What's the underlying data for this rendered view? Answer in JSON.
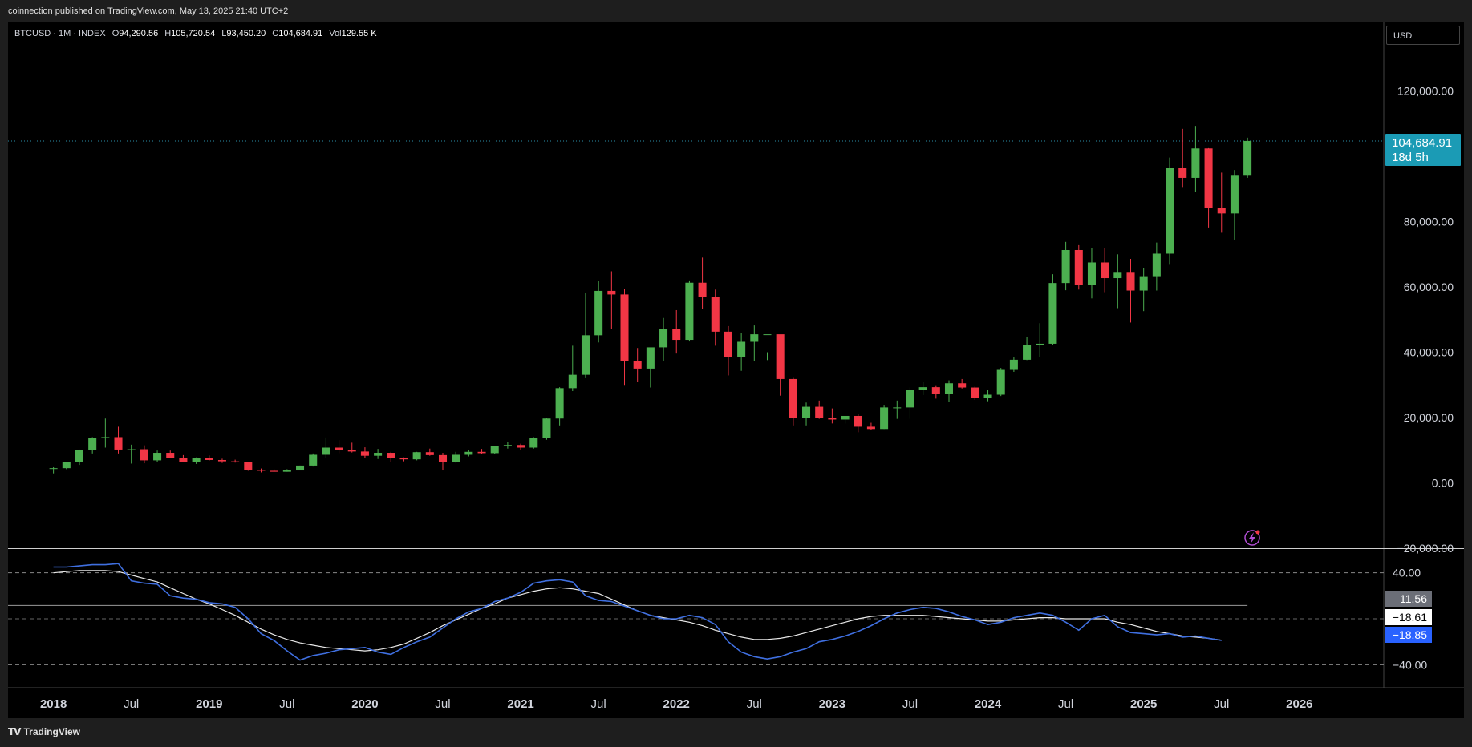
{
  "header": {
    "publisher_text": "coinnection published on TradingView.com, May 13, 2025 21:40 UTC+2"
  },
  "legend": {
    "symbol": "BTCUSD · 1M · INDEX",
    "o_label": "O",
    "o": "94,290.56",
    "h_label": "H",
    "h": "105,720.54",
    "l_label": "L",
    "l": "93,450.20",
    "c_label": "C",
    "c": "104,684.91",
    "vol_label": "Vol",
    "vol": "129.55 K"
  },
  "currency": "USD",
  "price_badge": {
    "price": "104,684.91",
    "countdown": "18d 5h",
    "color": "#1b9bb5"
  },
  "rsi_badges": [
    {
      "value": "11.56",
      "bg": "#6b6e77",
      "fg": "#ffffff"
    },
    {
      "value": "−18.61",
      "bg": "#ffffff",
      "fg": "#000000"
    },
    {
      "value": "−18.85",
      "bg": "#2962ff",
      "fg": "#ffffff"
    }
  ],
  "footer": {
    "brand": "TradingView",
    "logo_mark": "TV"
  },
  "colors": {
    "up": "#4caf50",
    "down": "#f23645",
    "rsi": "#3f6fe0",
    "signal": "#e8e8e8",
    "background": "#000000"
  },
  "chart_data": [
    {
      "type": "candlestick",
      "x_axis": {
        "tick_labels": [
          "2018",
          "Jul",
          "2019",
          "Jul",
          "2020",
          "Jul",
          "2021",
          "Jul",
          "2022",
          "Jul",
          "2023",
          "Jul",
          "2024",
          "Jul",
          "2025",
          "Jul",
          "2026"
        ],
        "tick_months": [
          0,
          6,
          12,
          18,
          24,
          30,
          36,
          42,
          48,
          54,
          60,
          66,
          72,
          78,
          84,
          90,
          96
        ],
        "range_months": [
          -3.5,
          102.5
        ]
      },
      "y_axis": {
        "ylim": [
          -20000,
          141000
        ],
        "tick_values": [
          -20000,
          0,
          20000,
          40000,
          60000,
          80000,
          120000
        ],
        "tick_labels": [
          "−20,000.00",
          "0.00",
          "20,000.00",
          "40,000.00",
          "60,000.00",
          "80,000.00",
          "120,000.00"
        ]
      },
      "last_price": 104684.91,
      "candles": [
        [
          4300,
          4800,
          2900,
          4500
        ],
        [
          4500,
          6500,
          4200,
          6300
        ],
        [
          6300,
          10200,
          5500,
          10000
        ],
        [
          10000,
          14000,
          9000,
          13800
        ],
        [
          13800,
          19700,
          10800,
          14000
        ],
        [
          14000,
          17200,
          9000,
          10200
        ],
        [
          10200,
          11700,
          5900,
          10300
        ],
        [
          10300,
          11500,
          6000,
          6900
        ],
        [
          6900,
          9900,
          6500,
          9200
        ],
        [
          9200,
          9900,
          8700,
          7500
        ],
        [
          7500,
          8500,
          7100,
          6400
        ],
        [
          6400,
          7800,
          5800,
          7700
        ],
        [
          7700,
          8400,
          6800,
          7000
        ],
        [
          7000,
          7400,
          6100,
          6600
        ],
        [
          6600,
          7100,
          6200,
          6300
        ],
        [
          6300,
          6500,
          3700,
          4000
        ],
        [
          4000,
          4400,
          3200,
          3700
        ],
        [
          3700,
          4100,
          3400,
          3400
        ],
        [
          3400,
          4200,
          3400,
          3800
        ],
        [
          3800,
          5300,
          3900,
          5300
        ],
        [
          5300,
          9000,
          5000,
          8600
        ],
        [
          8600,
          13900,
          7600,
          10800
        ],
        [
          10800,
          13100,
          9100,
          10100
        ],
        [
          10100,
          12300,
          9300,
          9600
        ],
        [
          9600,
          10900,
          7700,
          8300
        ],
        [
          8300,
          10400,
          7300,
          9200
        ],
        [
          9200,
          9500,
          6500,
          7600
        ],
        [
          7600,
          7800,
          6600,
          7200
        ],
        [
          7200,
          9500,
          6900,
          9400
        ],
        [
          9400,
          10500,
          8300,
          8500
        ],
        [
          8500,
          9200,
          3800,
          6400
        ],
        [
          6400,
          9500,
          6200,
          8600
        ],
        [
          8600,
          10000,
          8100,
          9500
        ],
        [
          9500,
          10400,
          8900,
          9100
        ],
        [
          9100,
          9800,
          8900,
          11300
        ],
        [
          11300,
          12500,
          10500,
          11600
        ],
        [
          11600,
          12000,
          10000,
          10800
        ],
        [
          10800,
          14000,
          10500,
          13800
        ],
        [
          13800,
          19800,
          13200,
          19700
        ],
        [
          19700,
          29300,
          17600,
          29000
        ],
        [
          29000,
          42000,
          28100,
          33100
        ],
        [
          33100,
          58300,
          32300,
          45200
        ],
        [
          45200,
          61800,
          43000,
          58800
        ],
        [
          58800,
          64800,
          47000,
          57700
        ],
        [
          57700,
          59500,
          30000,
          37300
        ],
        [
          37300,
          41300,
          31000,
          35000
        ],
        [
          35000,
          36600,
          29200,
          41500
        ],
        [
          41500,
          50500,
          37300,
          47100
        ],
        [
          47100,
          52900,
          39600,
          43800
        ],
        [
          43800,
          62000,
          43300,
          61300
        ],
        [
          61300,
          69000,
          53300,
          57000
        ],
        [
          57000,
          59200,
          42000,
          46300
        ],
        [
          46300,
          48000,
          32900,
          38500
        ],
        [
          38500,
          45800,
          34300,
          43200
        ],
        [
          43200,
          48200,
          37300,
          45500
        ],
        [
          45500,
          40000,
          37600,
          45500
        ],
        [
          45500,
          40000,
          26700,
          31800
        ],
        [
          31800,
          32400,
          17600,
          19800
        ],
        [
          19800,
          24600,
          17600,
          23300
        ],
        [
          23300,
          25200,
          19600,
          20000
        ],
        [
          20000,
          22800,
          18200,
          19400
        ],
        [
          19400,
          20500,
          18200,
          20500
        ],
        [
          20500,
          21100,
          15500,
          17200
        ],
        [
          17200,
          18400,
          16300,
          16500
        ],
        [
          16500,
          23900,
          16500,
          23100
        ],
        [
          23100,
          25200,
          19600,
          23100
        ],
        [
          23100,
          29200,
          19600,
          28500
        ],
        [
          28500,
          30900,
          26900,
          29300
        ],
        [
          29300,
          29900,
          25800,
          27200
        ],
        [
          27200,
          31400,
          24800,
          30500
        ],
        [
          30500,
          31800,
          28900,
          29200
        ],
        [
          29200,
          29500,
          25400,
          26000
        ],
        [
          26000,
          28500,
          25000,
          27000
        ],
        [
          27000,
          35200,
          26600,
          34600
        ],
        [
          34600,
          38400,
          34000,
          37700
        ],
        [
          37700,
          44700,
          37600,
          42300
        ],
        [
          42300,
          48900,
          38600,
          42600
        ],
        [
          42600,
          63900,
          42100,
          61200
        ],
        [
          61200,
          73800,
          59000,
          71300
        ],
        [
          71300,
          72800,
          59200,
          60700
        ],
        [
          60700,
          71900,
          56500,
          67500
        ],
        [
          67500,
          71900,
          58400,
          62700
        ],
        [
          62700,
          70000,
          53500,
          64600
        ],
        [
          64600,
          68600,
          49100,
          58900
        ],
        [
          58900,
          65900,
          52600,
          63300
        ],
        [
          63300,
          73600,
          58900,
          70200
        ],
        [
          70200,
          99600,
          66800,
          96400
        ],
        [
          96400,
          108400,
          90600,
          93400
        ],
        [
          93400,
          109300,
          89200,
          102400
        ],
        [
          102400,
          102500,
          78200,
          84300
        ],
        [
          84300,
          95000,
          76600,
          82500
        ],
        [
          82500,
          95800,
          74500,
          94300
        ],
        [
          94300,
          105700,
          93400,
          104700
        ]
      ]
    },
    {
      "type": "line",
      "y_axis": {
        "ylim": [
          -60,
          60
        ],
        "tick_values": [
          40,
          -40
        ],
        "tick_labels": [
          "40.00",
          "−40.00"
        ],
        "bands_dashed": [
          40,
          -40
        ],
        "middle_line": 0
      },
      "series": [
        {
          "values": [
            45,
            45,
            46,
            47,
            47,
            48,
            33,
            31,
            30,
            20,
            18,
            17,
            14,
            13,
            10,
            0,
            -13,
            -19,
            -28,
            -36,
            -32,
            -30,
            -27,
            -26,
            -25,
            -29,
            -31,
            -25,
            -20,
            -16,
            -8,
            0,
            6,
            9,
            15,
            18,
            23,
            31,
            33,
            34,
            32,
            20,
            16,
            15,
            11,
            7,
            3,
            0,
            0,
            3,
            1,
            -5,
            -20,
            -29,
            -33,
            -35,
            -33,
            -29,
            -26,
            -20,
            -18,
            -15,
            -11,
            -6,
            0,
            5,
            8,
            10,
            9,
            6,
            2,
            -1,
            -5,
            -3,
            1,
            3,
            5,
            3,
            -3,
            -10,
            0,
            3,
            -7,
            -12,
            -13,
            -14,
            -13,
            -16,
            -15,
            -17,
            -18.85
          ]
        },
        {
          "values": [
            40,
            41,
            42,
            42,
            42,
            41,
            38,
            35,
            32,
            27,
            22,
            17,
            13,
            8,
            3,
            -3,
            -9,
            -14,
            -18,
            -21,
            -23,
            -25,
            -26,
            -27,
            -28,
            -27,
            -25,
            -22,
            -17,
            -12,
            -6,
            -1,
            4,
            9,
            13,
            18,
            21,
            24,
            26,
            27,
            26,
            24,
            22,
            17,
            12,
            7,
            3,
            1,
            -1,
            -3,
            -6,
            -10,
            -13,
            -16,
            -18,
            -18,
            -17,
            -15,
            -12,
            -9,
            -6,
            -3,
            0,
            2,
            3,
            3,
            3,
            3,
            2,
            1,
            0,
            -1,
            -2,
            -2,
            -1,
            0,
            1,
            1,
            0,
            0,
            0,
            0,
            -3,
            -5,
            -8,
            -11,
            -13,
            -15,
            -16,
            -17,
            -18.61
          ]
        },
        {
          "values": [
            11.56,
            11.56
          ]
        }
      ]
    }
  ]
}
